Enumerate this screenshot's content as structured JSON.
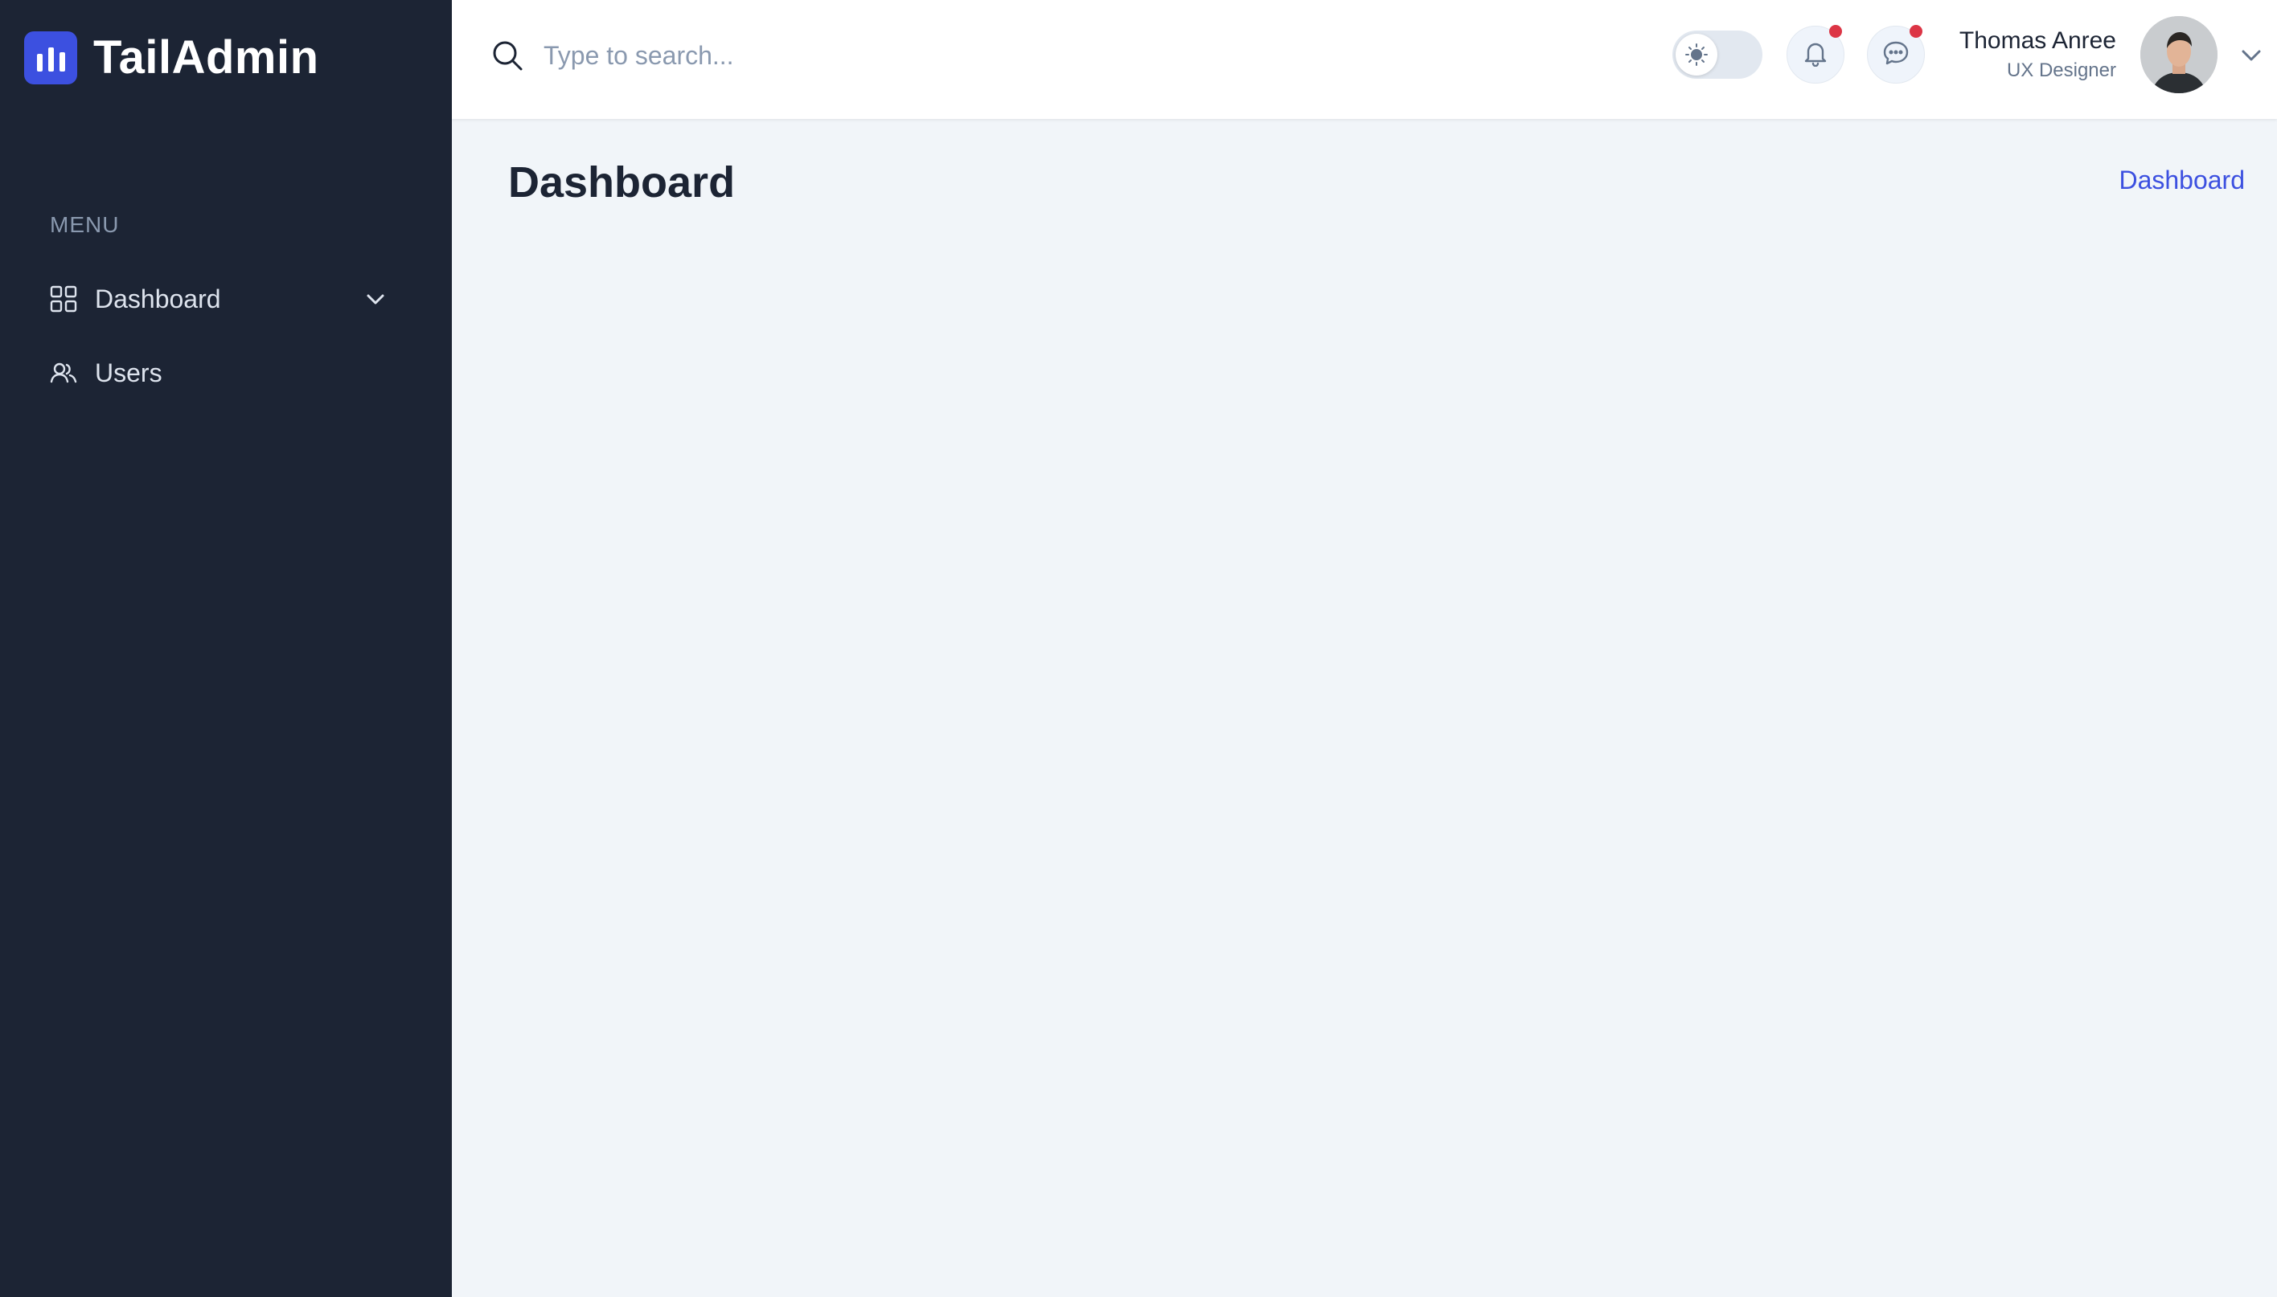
{
  "brand": {
    "name": "TailAdmin",
    "logo_icon": "bar-chart-logo-icon",
    "color": "#3c50e0"
  },
  "sidebar": {
    "menu_heading": "MENU",
    "items": [
      {
        "label": "Dashboard",
        "icon": "grid-icon",
        "expandable": true
      },
      {
        "label": "Users",
        "icon": "users-icon",
        "expandable": false
      }
    ],
    "background": "#1c2434"
  },
  "header": {
    "search": {
      "placeholder": "Type to search...",
      "value": ""
    },
    "theme_toggle": {
      "mode": "light"
    },
    "notifications": {
      "icon": "bell-icon",
      "unread": true
    },
    "messages": {
      "icon": "chat-icon",
      "unread": true
    },
    "user": {
      "name": "Thomas Anree",
      "role": "UX Designer"
    }
  },
  "main": {
    "title": "Dashboard",
    "breadcrumb": "Dashboard"
  },
  "colors": {
    "accent": "#3c50e0",
    "badge": "#dc3545",
    "background": "#f1f5f9"
  }
}
